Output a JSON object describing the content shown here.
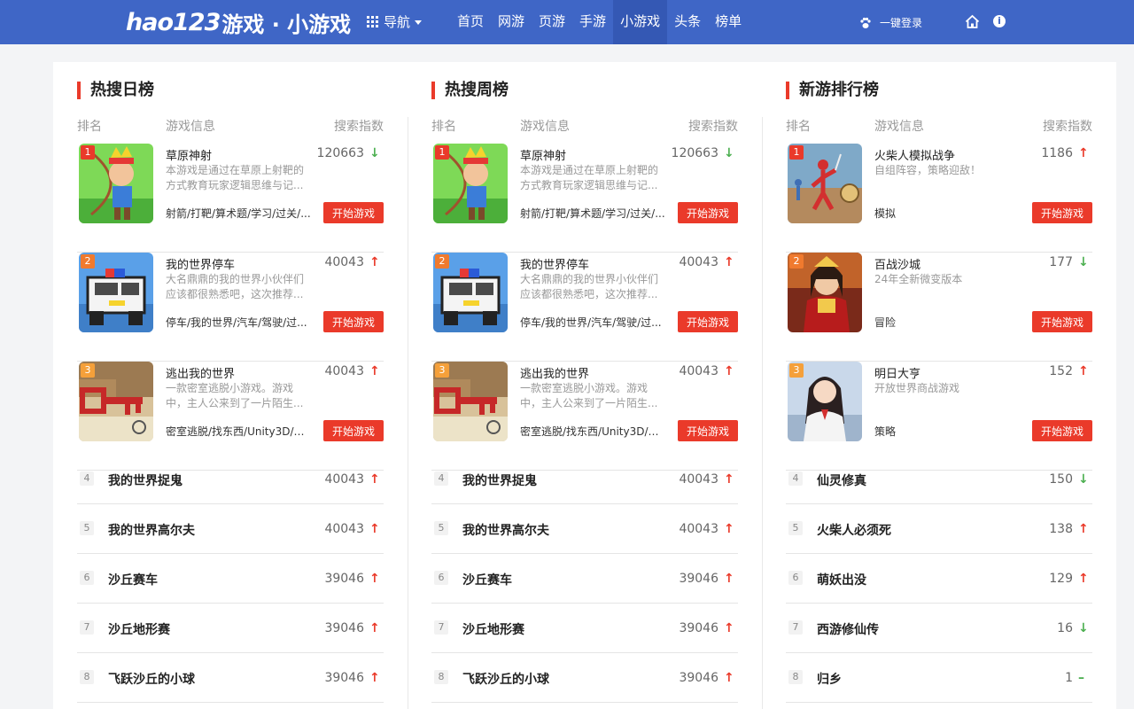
{
  "header": {
    "logo_brand": "hao123",
    "logo_text": "游戏 · 小游戏",
    "nav_menu": "导航",
    "tabs": [
      "首页",
      "网游",
      "页游",
      "手游",
      "小游戏",
      "头条",
      "榜单"
    ],
    "active_tab": "小游戏",
    "login": "一键登录",
    "brand_color": "#3f66c6",
    "accent_color": "#ea3a2a"
  },
  "columns": [
    {
      "title": "热搜日榜",
      "head_rank": "排名",
      "head_info": "游戏信息",
      "head_index": "搜索指数",
      "top": [
        {
          "rank": "1",
          "name": "草原神射",
          "desc": "本游戏是通过在草原上射靶的方式教育玩家逻辑思维与记...",
          "tags": "射箭/打靶/算术题/学习/过关/...",
          "score": "120663",
          "trend": "down",
          "button": "开始游戏",
          "icon": "archer-game-icon"
        },
        {
          "rank": "2",
          "name": "我的世界停车",
          "desc": "大名鼎鼎的我的世界小伙伴们应该都很熟悉吧，这次推荐...",
          "tags": "停车/我的世界/汽车/驾驶/过...",
          "score": "40043",
          "trend": "up",
          "button": "开始游戏",
          "icon": "police-car-game-icon"
        },
        {
          "rank": "3",
          "name": "逃出我的世界",
          "desc": "一款密室逃脱小游戏。游戏中，主人公来到了一片陌生...",
          "tags": "密室逃脱/找东西/Unity3D/解...",
          "score": "40043",
          "trend": "up",
          "button": "开始游戏",
          "icon": "key-game-icon"
        }
      ],
      "rows": [
        {
          "rank": "4",
          "name": "我的世界捉鬼",
          "score": "40043",
          "trend": "up"
        },
        {
          "rank": "5",
          "name": "我的世界高尔夫",
          "score": "40043",
          "trend": "up"
        },
        {
          "rank": "6",
          "name": "沙丘赛车",
          "score": "39046",
          "trend": "up"
        },
        {
          "rank": "7",
          "name": "沙丘地形赛",
          "score": "39046",
          "trend": "up"
        },
        {
          "rank": "8",
          "name": "飞跃沙丘的小球",
          "score": "39046",
          "trend": "up"
        }
      ]
    },
    {
      "title": "热搜周榜",
      "head_rank": "排名",
      "head_info": "游戏信息",
      "head_index": "搜索指数",
      "top": [
        {
          "rank": "1",
          "name": "草原神射",
          "desc": "本游戏是通过在草原上射靶的方式教育玩家逻辑思维与记...",
          "tags": "射箭/打靶/算术题/学习/过关/...",
          "score": "120663",
          "trend": "down",
          "button": "开始游戏",
          "icon": "archer-game-icon"
        },
        {
          "rank": "2",
          "name": "我的世界停车",
          "desc": "大名鼎鼎的我的世界小伙伴们应该都很熟悉吧，这次推荐...",
          "tags": "停车/我的世界/汽车/驾驶/过...",
          "score": "40043",
          "trend": "up",
          "button": "开始游戏",
          "icon": "police-car-game-icon"
        },
        {
          "rank": "3",
          "name": "逃出我的世界",
          "desc": "一款密室逃脱小游戏。游戏中，主人公来到了一片陌生...",
          "tags": "密室逃脱/找东西/Unity3D/解...",
          "score": "40043",
          "trend": "up",
          "button": "开始游戏",
          "icon": "key-game-icon"
        }
      ],
      "rows": [
        {
          "rank": "4",
          "name": "我的世界捉鬼",
          "score": "40043",
          "trend": "up"
        },
        {
          "rank": "5",
          "name": "我的世界高尔夫",
          "score": "40043",
          "trend": "up"
        },
        {
          "rank": "6",
          "name": "沙丘赛车",
          "score": "39046",
          "trend": "up"
        },
        {
          "rank": "7",
          "name": "沙丘地形赛",
          "score": "39046",
          "trend": "up"
        },
        {
          "rank": "8",
          "name": "飞跃沙丘的小球",
          "score": "39046",
          "trend": "up"
        }
      ]
    },
    {
      "title": "新游排行榜",
      "head_rank": "排名",
      "head_info": "游戏信息",
      "head_index": "搜索指数",
      "top": [
        {
          "rank": "1",
          "name": "火柴人模拟战争",
          "desc": "自组阵容，策略迎敌！",
          "tags": "模拟",
          "score": "1186",
          "trend": "up",
          "button": "开始游戏",
          "icon": "stickman-war-game-icon"
        },
        {
          "rank": "2",
          "name": "百战沙城",
          "desc": "24年全新微变版本",
          "tags": "冒险",
          "score": "177",
          "trend": "down",
          "button": "开始游戏",
          "icon": "warrior-game-icon"
        },
        {
          "rank": "3",
          "name": "明日大亨",
          "desc": "开放世界商战游戏",
          "tags": "策略",
          "score": "152",
          "trend": "up",
          "button": "开始游戏",
          "icon": "businesswoman-game-icon"
        }
      ],
      "rows": [
        {
          "rank": "4",
          "name": "仙灵修真",
          "score": "150",
          "trend": "down"
        },
        {
          "rank": "5",
          "name": "火柴人必须死",
          "score": "138",
          "trend": "up"
        },
        {
          "rank": "6",
          "name": "萌妖出没",
          "score": "129",
          "trend": "up"
        },
        {
          "rank": "7",
          "name": "西游修仙传",
          "score": "16",
          "trend": "down"
        },
        {
          "rank": "8",
          "name": "归乡",
          "score": "1",
          "trend": "flat"
        }
      ]
    }
  ]
}
